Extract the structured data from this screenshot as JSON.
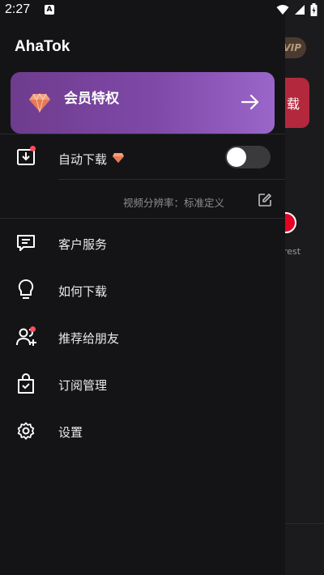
{
  "status_bar": {
    "time": "2:27",
    "notification_icon": "A"
  },
  "background": {
    "vip_badge": "VIP",
    "download_button": "载",
    "partial_label": "rest"
  },
  "drawer": {
    "app_title": "AhaTok",
    "vip_card": {
      "title": "会员特权",
      "arrow_icon": "arrow-right-icon",
      "gem_icon": "diamond-icon"
    },
    "auto_download": {
      "label": "自动下载",
      "toggle_on": false
    },
    "resolution": {
      "label": "视频分辨率：标准定义"
    },
    "menu": [
      {
        "label": "客户服务",
        "icon": "customer-service-icon"
      },
      {
        "label": "如何下载",
        "icon": "lightbulb-icon"
      },
      {
        "label": "推荐给朋友",
        "icon": "share-friends-icon"
      },
      {
        "label": "订阅管理",
        "icon": "subscription-bag-icon"
      },
      {
        "label": "设置",
        "icon": "gear-icon"
      }
    ]
  },
  "colors": {
    "drawer_bg": "#141416",
    "card_gradient_start": "#6e3c8e",
    "card_gradient_end": "#9a66c9",
    "accent_red": "#ff4d5e"
  }
}
